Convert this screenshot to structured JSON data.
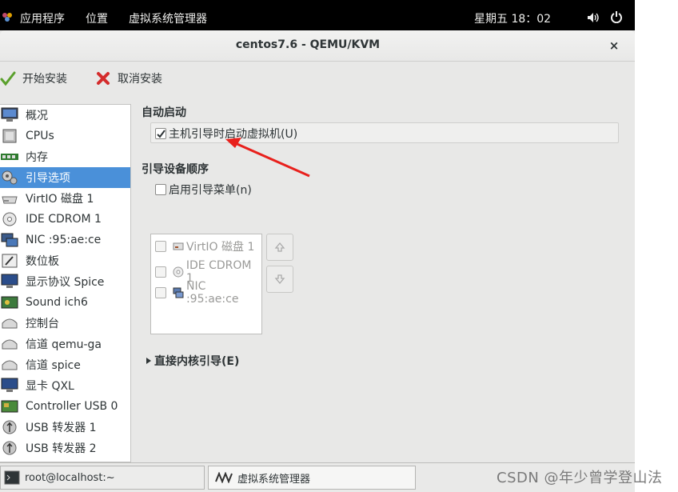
{
  "top_panel": {
    "menus": [
      "应用程序",
      "位置",
      "虚拟系统管理器"
    ],
    "clock": "星期五 18：02"
  },
  "window": {
    "title": "centos7.6 - QEMU/KVM",
    "close_symbol": "×"
  },
  "toolbar": {
    "begin_install": "开始安装",
    "cancel_install": "取消安装"
  },
  "sidebar": {
    "selected_index": 3,
    "items": [
      {
        "label": "概况",
        "icon": "monitor-icon"
      },
      {
        "label": "CPUs",
        "icon": "cpu-icon"
      },
      {
        "label": "内存",
        "icon": "memory-icon"
      },
      {
        "label": "引导选项",
        "icon": "boot-options-icon"
      },
      {
        "label": "VirtIO 磁盘 1",
        "icon": "disk-icon"
      },
      {
        "label": "IDE CDROM 1",
        "icon": "cdrom-icon"
      },
      {
        "label": "NIC :95:ae:ce",
        "icon": "nic-icon"
      },
      {
        "label": "数位板",
        "icon": "tablet-icon"
      },
      {
        "label": "显示协议 Spice",
        "icon": "display-icon"
      },
      {
        "label": "Sound ich6",
        "icon": "sound-icon"
      },
      {
        "label": "控制台",
        "icon": "console-icon"
      },
      {
        "label": "信道 qemu-ga",
        "icon": "channel-icon"
      },
      {
        "label": "信道 spice",
        "icon": "channel-icon"
      },
      {
        "label": "显卡 QXL",
        "icon": "video-icon"
      },
      {
        "label": "Controller USB 0",
        "icon": "controller-icon"
      },
      {
        "label": "USB 转发器 1",
        "icon": "usb-icon"
      },
      {
        "label": "USB 转发器 2",
        "icon": "usb-icon"
      }
    ]
  },
  "main": {
    "autostart_heading": "自动启动",
    "autostart_checkbox": {
      "label": "主机引导时启动虚拟机(U)",
      "checked": true
    },
    "boot_order_heading": "引导设备顺序",
    "boot_menu_checkbox": {
      "label": "启用引导菜单(n)",
      "checked": false
    },
    "boot_devices": [
      {
        "label": "VirtIO 磁盘 1",
        "icon": "disk-icon",
        "checked": false
      },
      {
        "label": "IDE CDROM 1",
        "icon": "cdrom-icon",
        "checked": false
      },
      {
        "label": "NIC :95:ae:ce",
        "icon": "nic-icon",
        "checked": false
      }
    ],
    "direct_kernel_boot": "直接内核引导(E)"
  },
  "taskbar": {
    "tasks": [
      "root@localhost:~",
      "虚拟系统管理器"
    ]
  },
  "watermark": "CSDN @年少曾学登山法",
  "colors": {
    "selection": "#4a90d9",
    "annotation_arrow": "#e8201c"
  }
}
